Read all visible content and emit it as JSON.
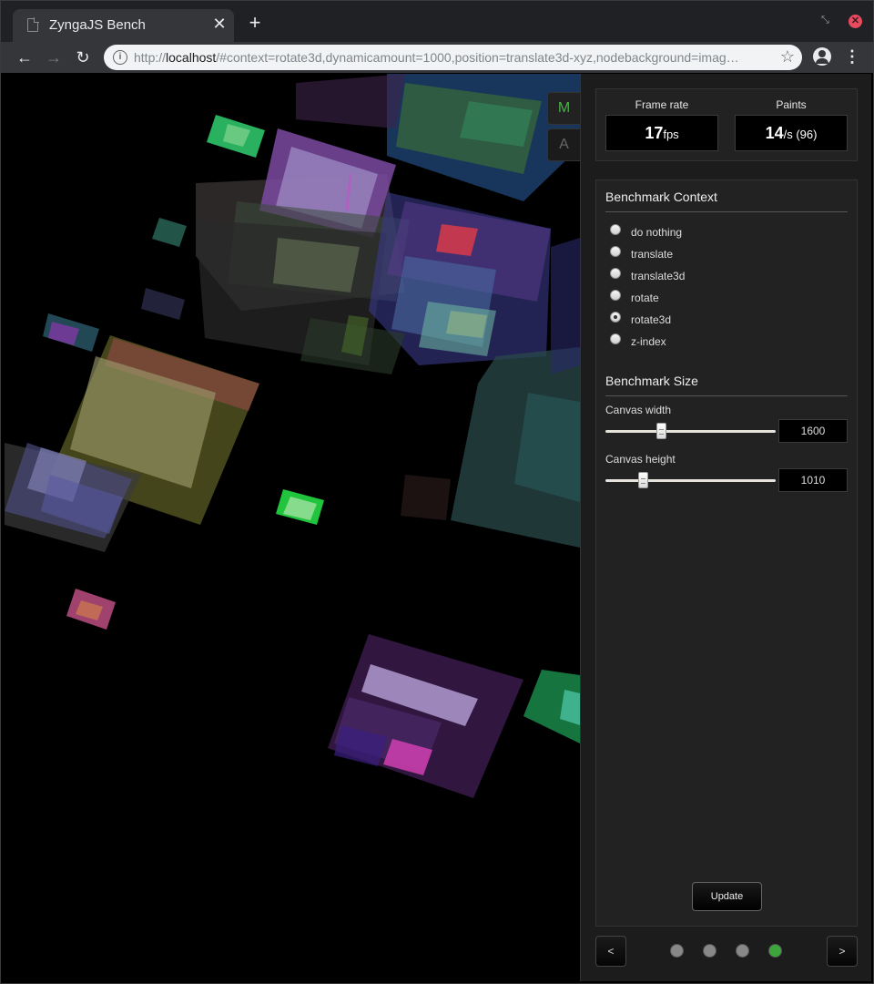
{
  "browser": {
    "tab_title": "ZyngaJS Bench",
    "url_scheme": "http://",
    "url_host": "localhost",
    "url_path": "/#context=rotate3d,dynamicamount=1000,position=translate3d-xyz,nodebackground=imag…"
  },
  "side_tabs": [
    "M",
    "A"
  ],
  "stats": {
    "frame_rate": {
      "label": "Frame rate",
      "value": "17",
      "unit": "fps"
    },
    "paints": {
      "label": "Paints",
      "value": "14",
      "unit": "/s (96)"
    }
  },
  "benchmark_context": {
    "title": "Benchmark Context",
    "options": [
      "do nothing",
      "translate",
      "translate3d",
      "rotate",
      "rotate3d",
      "z-index"
    ],
    "selected": "rotate3d"
  },
  "benchmark_size": {
    "title": "Benchmark Size",
    "canvas_width": {
      "label": "Canvas width",
      "value": "1600",
      "fraction": 0.33
    },
    "canvas_height": {
      "label": "Canvas height",
      "value": "1010",
      "fraction": 0.22
    }
  },
  "update_button": "Update",
  "pager": {
    "prev": "<",
    "next": ">",
    "pages": 4,
    "active_page": 4
  },
  "colors": {
    "accent_green": "#3ca63c",
    "tab_active_green": "#4cae4c"
  }
}
